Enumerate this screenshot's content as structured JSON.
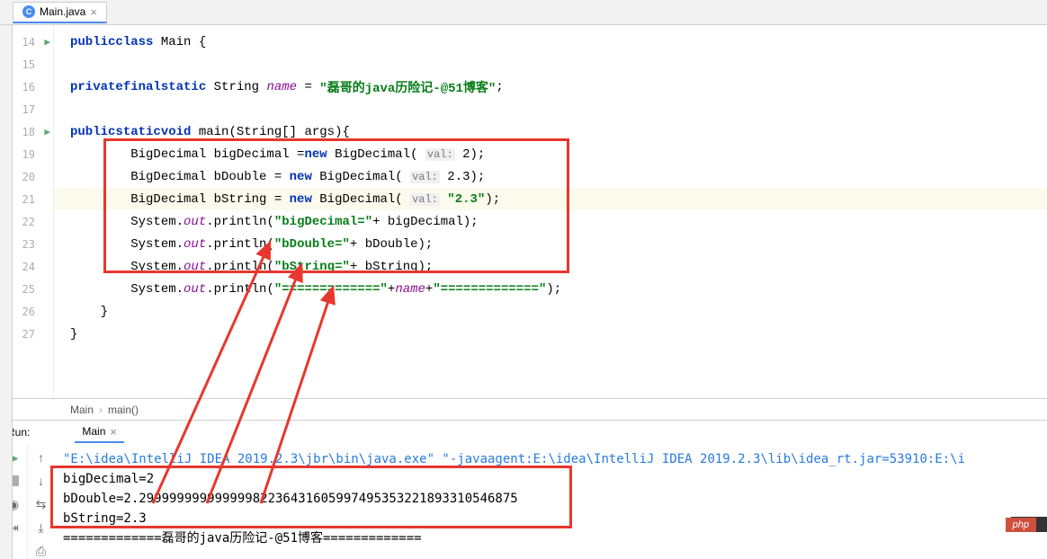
{
  "tab": {
    "icon_letter": "C",
    "filename": "Main.java"
  },
  "gutter": [
    "14",
    "15",
    "16",
    "17",
    "18",
    "19",
    "20",
    "21",
    "22",
    "23",
    "24",
    "25",
    "26",
    "27"
  ],
  "code": {
    "l14": {
      "kw1": "public",
      "kw2": "class",
      "name": " Main {",
      "pre": ""
    },
    "l16": {
      "kw1": "private",
      "kw2": "final",
      "kw3": "static",
      "type": " String ",
      "field": "name",
      "eq": " = ",
      "str": "\"磊哥的java历险记-@51博客\"",
      "semi": ";"
    },
    "l18": {
      "kw1": "public",
      "kw2": "static",
      "kw3": "void",
      "rest": " main(String[] args){"
    },
    "l19": {
      "pre": "        BigDecimal bigDecimal =",
      "kw": "new",
      "mid": " BigDecimal( ",
      "hint": "val:",
      "arg": " 2",
      "end": ");"
    },
    "l20": {
      "pre": "        BigDecimal bDouble = ",
      "kw": "new",
      "mid": " BigDecimal( ",
      "hint": "val:",
      "arg": " 2.3",
      "end": ");"
    },
    "l21": {
      "pre": "        BigDecimal bString = ",
      "kw": "new",
      "mid": " BigDecimal( ",
      "hint": "val:",
      "arg": " ",
      "str": "\"2.3\"",
      "end": ");"
    },
    "l22": {
      "pre": "        System.",
      "field": "out",
      "mid": ".println(",
      "str": "\"bigDecimal=\"",
      "end": "+ bigDecimal);"
    },
    "l23": {
      "pre": "        System.",
      "field": "out",
      "mid": ".println(",
      "str": "\"bDouble=\"",
      "end": "+ bDouble);"
    },
    "l24": {
      "pre": "        System.",
      "field": "out",
      "mid": ".println(",
      "str": "\"bString=\"",
      "end": "+ bString);"
    },
    "l25": {
      "pre": "        System.",
      "field": "out",
      "mid": ".println(",
      "str1": "\"=============\"",
      "plus1": "+",
      "field2": "name",
      "plus2": "+",
      "str2": "\"=============\"",
      "end": ");"
    },
    "l26": "    }",
    "l27": "}"
  },
  "breadcrumb": {
    "a": "Main",
    "sep": "›",
    "b": "main()"
  },
  "run": {
    "label": "Run:",
    "tab": "Main",
    "cmd": "\"E:\\idea\\IntelliJ IDEA 2019.2.3\\jbr\\bin\\java.exe\" \"-javaagent:E:\\idea\\IntelliJ IDEA 2019.2.3\\lib\\idea_rt.jar=53910:E:\\i",
    "out1": "bigDecimal=2",
    "out2": "bDouble=2.29999999999999982236431605997495353221893310546875",
    "out3": "bString=2.3",
    "out4": "=============磊哥的java历险记-@51博客============="
  },
  "watermark": "php"
}
